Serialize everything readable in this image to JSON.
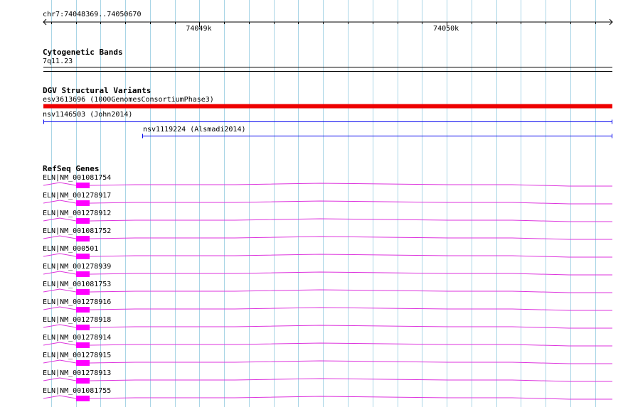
{
  "ruler": {
    "coordinates": "chr7:74048369..74050670",
    "ticks": [
      {
        "pos": 74049000,
        "label": "74049k"
      },
      {
        "pos": 74050000,
        "label": "74050k"
      }
    ]
  },
  "region": {
    "start": 74048369,
    "end": 74050670
  },
  "colors": {
    "grid": "#a9d5e6",
    "variant_bar": "#ee0000",
    "variant_line": "#0000ee",
    "gene_line": "#dd33dd",
    "exon": "#ff00ff"
  },
  "tracks": {
    "cytoband": {
      "title": "Cytogenetic Bands",
      "band": "7q11.23"
    },
    "dgv": {
      "title": "DGV Structural Variants",
      "features": [
        {
          "label": "esv3613696 (1000GenomesConsortiumPhase3)",
          "start": 74048369,
          "end": 74050670,
          "style": "bar"
        },
        {
          "label": "nsv1146503 (John2014)",
          "start": 74048369,
          "end": 74050670,
          "style": "line"
        },
        {
          "label": "nsv1119224 (Alsmadi2014)",
          "start": 74048769,
          "end": 74050670,
          "style": "line"
        }
      ]
    },
    "refseq": {
      "title": "RefSeq Genes",
      "genes": [
        "ELN|NM_001081754",
        "ELN|NM_001278917",
        "ELN|NM_001278912",
        "ELN|NM_001081752",
        "ELN|NM_000501",
        "ELN|NM_001278939",
        "ELN|NM_001081753",
        "ELN|NM_001278916",
        "ELN|NM_001278918",
        "ELN|NM_001278914",
        "ELN|NM_001278915",
        "ELN|NM_001278913",
        "ELN|NM_001081755"
      ],
      "exon": {
        "start": 74048500,
        "end": 74048557
      }
    }
  }
}
